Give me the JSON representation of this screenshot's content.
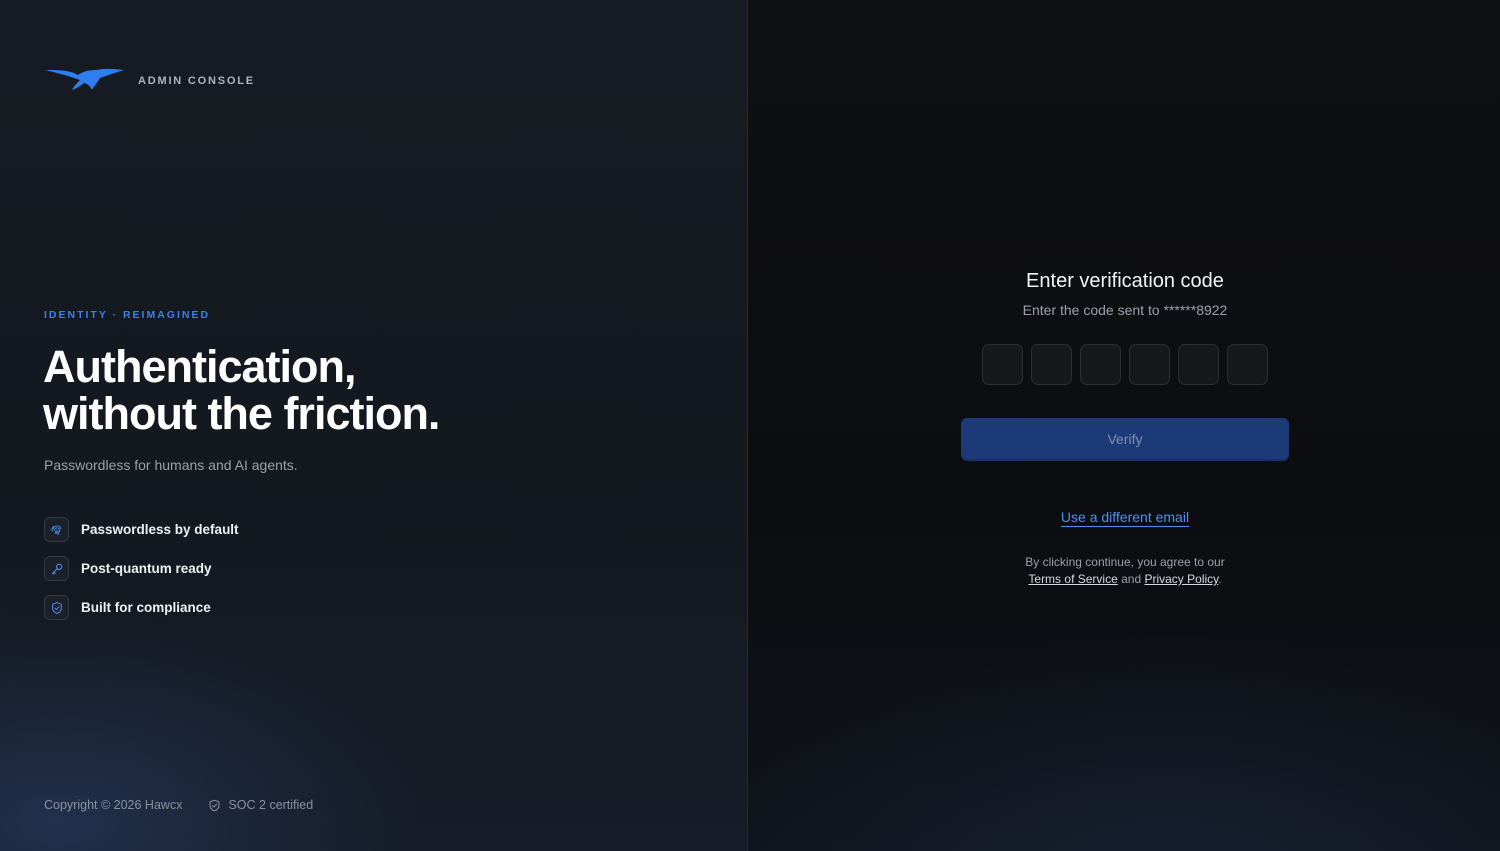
{
  "brand": {
    "name": "ADMIN CONSOLE",
    "logo_color": "#2f7ef0"
  },
  "hero": {
    "eyebrow": "IDENTITY · REIMAGINED",
    "headline_line1": "Authentication,",
    "headline_line2": "without the friction.",
    "tagline": "Passwordless for humans and AI agents."
  },
  "features": [
    {
      "icon": "fingerprint-icon",
      "label": "Passwordless by default"
    },
    {
      "icon": "key-icon",
      "label": "Post-quantum ready"
    },
    {
      "icon": "shield-check-icon",
      "label": "Built for compliance"
    }
  ],
  "footer": {
    "copyright": "Copyright © 2026 Hawcx",
    "cert": "SOC 2 certified"
  },
  "verify": {
    "title": "Enter verification code",
    "subtitle": "Enter the code sent to ******8922",
    "code_digits": [
      "",
      "",
      "",
      "",
      "",
      ""
    ],
    "button_label": "Verify",
    "alt_link": "Use a different email",
    "legal_prefix": "By clicking continue, you agree to our",
    "terms_label": "Terms of Service",
    "legal_and": "and",
    "privacy_label": "Privacy Policy",
    "legal_suffix": "."
  },
  "colors": {
    "accent": "#3f7fe6",
    "link": "#4d8ff5",
    "button_bg": "#1c3a78"
  }
}
